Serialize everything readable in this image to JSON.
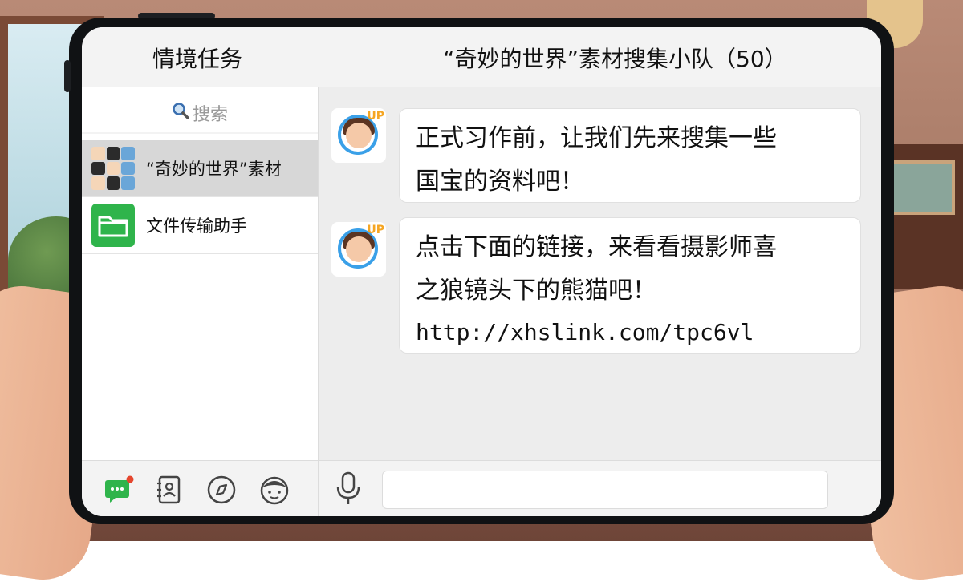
{
  "sidebar": {
    "title": "情境任务",
    "search_placeholder": "搜索",
    "chats": [
      {
        "name": "“奇妙的世界”素材",
        "avatar": "group-avatar-icon"
      },
      {
        "name": "文件传输助手",
        "avatar": "folder-icon"
      }
    ]
  },
  "chat": {
    "title": "“奇妙的世界”素材搜集小队（50）",
    "messages": [
      {
        "line1": "正式习作前，让我们先来搜集一些",
        "line2": "国宝的资料吧！"
      },
      {
        "line1": "点击下面的链接，来看看摄影师喜",
        "line2": "之狼镜头下的熊猫吧！",
        "link": "http://xhslink.com/tpc6vl"
      }
    ],
    "avatar_badge": "UP"
  },
  "bottom_tabs": [
    "chat-bubble-icon",
    "contacts-icon",
    "compass-icon",
    "face-icon"
  ],
  "colors": {
    "accent_green": "#2fb44b",
    "badge_red": "#e5462e",
    "avatar_ring_blue": "#3aa0e8"
  }
}
